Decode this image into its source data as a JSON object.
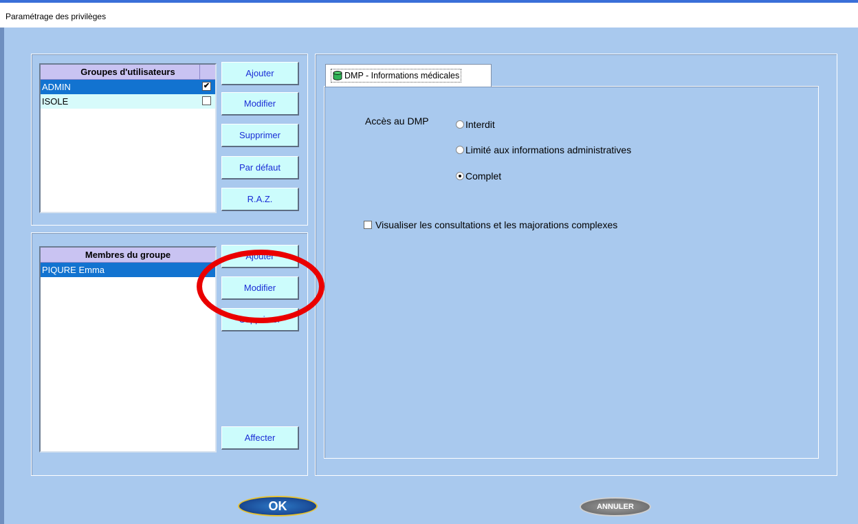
{
  "window": {
    "title": "Paramétrage des privilèges"
  },
  "groups": {
    "header": "Groupes d'utilisateurs",
    "rows": [
      {
        "name": "ADMIN",
        "checked": "✔"
      },
      {
        "name": "ISOLE",
        "checked": ""
      }
    ],
    "buttons": {
      "add": "Ajouter",
      "edit": "Modifier",
      "delete": "Supprimer",
      "default": "Par défaut",
      "reset": "R.A.Z."
    }
  },
  "members": {
    "header": "Membres du groupe",
    "rows": [
      {
        "name": "PIQURE Emma"
      }
    ],
    "buttons": {
      "add": "Ajouter",
      "edit": "Modifier",
      "delete": "Supprimer",
      "assign": "Affecter"
    }
  },
  "tab": {
    "icon": "database-icon",
    "label": "DMP - Informations médicales"
  },
  "dmp": {
    "access_label": "Accès au DMP",
    "options": [
      "Interdit",
      "Limité aux informations administratives",
      "Complet"
    ],
    "selected": "Complet",
    "checkbox_label": "Visualiser les consultations et les majorations complexes",
    "checkbox_checked": false
  },
  "footer": {
    "ok": "OK",
    "cancel": "ANNULER"
  },
  "colors": {
    "background": "#a9c9ee",
    "button": "#ccfcfc",
    "button_text": "#1a2cd6",
    "selection": "#1273d0",
    "annotation": "#ea0000"
  }
}
